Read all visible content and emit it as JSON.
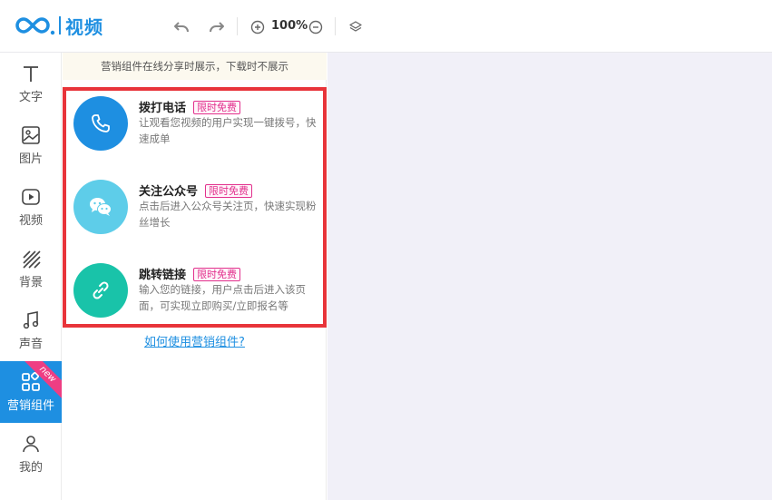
{
  "app": {
    "name": "视频",
    "brand_color": "#1e8fe1"
  },
  "toolbar": {
    "zoom_label": "100%"
  },
  "nav": {
    "items": [
      {
        "label": "文字",
        "icon": "text-icon"
      },
      {
        "label": "图片",
        "icon": "image-icon"
      },
      {
        "label": "视频",
        "icon": "video-icon"
      },
      {
        "label": "背景",
        "icon": "background-icon"
      },
      {
        "label": "声音",
        "icon": "music-icon"
      },
      {
        "label": "营销组件",
        "icon": "components-icon",
        "active": true,
        "tag": "new"
      },
      {
        "label": "我的",
        "icon": "user-icon"
      }
    ]
  },
  "panel": {
    "notice": "营销组件在线分享时展示，下载时不展示",
    "cards": [
      {
        "title": "拨打电话",
        "badge": "限时免费",
        "desc": "让观看您视频的用户实现一键拨号，快速成单",
        "icon": "phone-icon",
        "color": "#1e8fe1"
      },
      {
        "title": "关注公众号",
        "badge": "限时免费",
        "desc": "点击后进入公众号关注页，快速实现粉丝增长",
        "icon": "wechat-icon",
        "color": "#5ecde9"
      },
      {
        "title": "跳转链接",
        "badge": "限时免费",
        "desc": "输入您的链接，用户点击后进入该页面，可实现立即购买/立即报名等",
        "icon": "link-icon",
        "color": "#19c3a9"
      }
    ],
    "help_link": "如何使用营销组件?"
  },
  "colors": {
    "highlight_border": "#e8343a",
    "badge": "#e2318d",
    "canvas_bg": "#f1f0f8"
  }
}
